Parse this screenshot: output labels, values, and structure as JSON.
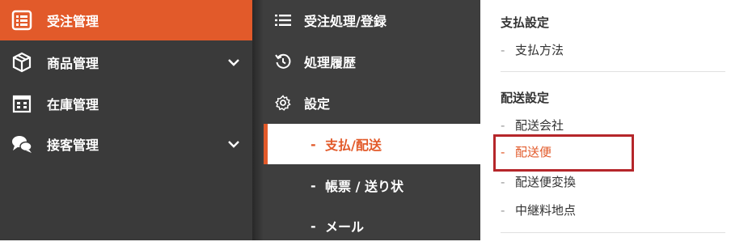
{
  "sidebar": {
    "items": [
      {
        "label": "受注管理",
        "icon": "order-list-icon",
        "active": true
      },
      {
        "label": "商品管理",
        "icon": "box-icon",
        "has_chevron": true
      },
      {
        "label": "在庫管理",
        "icon": "warehouse-icon"
      },
      {
        "label": "接客管理",
        "icon": "chat-bubbles-icon",
        "has_chevron": true
      }
    ]
  },
  "submenu": {
    "items": [
      {
        "label": "受注処理/登録",
        "icon": "list-icon"
      },
      {
        "label": "処理履歴",
        "icon": "history-icon"
      },
      {
        "label": "設定",
        "icon": "gear-icon"
      }
    ],
    "children": [
      {
        "label": "支払/配送",
        "selected": true
      },
      {
        "label": "帳票 / 送り状"
      },
      {
        "label": "メール"
      }
    ]
  },
  "panel": {
    "sections": [
      {
        "title": "支払設定",
        "links": [
          "支払方法"
        ]
      },
      {
        "title": "配送設定",
        "links": [
          "配送会社",
          "配送便",
          "配送便変換",
          "中継料地点"
        ]
      }
    ],
    "current_link": "配送便"
  },
  "colors": {
    "accent": "#e25a2a",
    "sidebar_bg": "#3a3a3a",
    "highlight_box": "#b5262a"
  }
}
